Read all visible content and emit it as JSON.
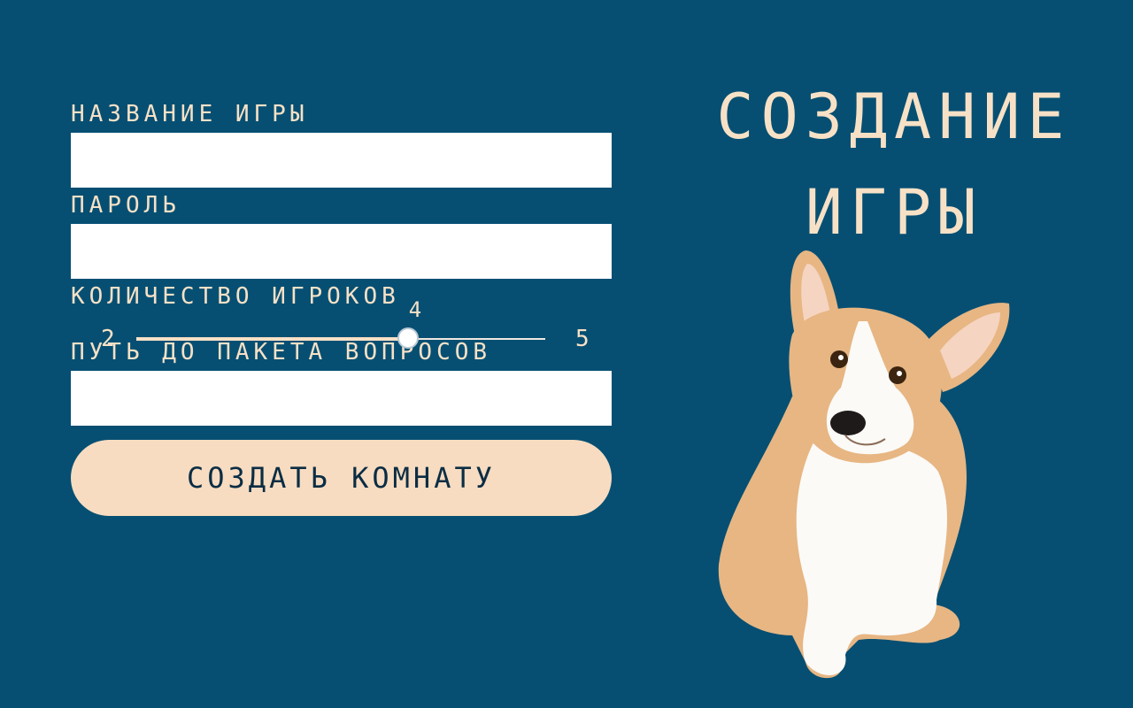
{
  "form": {
    "game_name_label": "НАЗВАНИЕ ИГРЫ",
    "game_name_value": "",
    "password_label": "ПАРОЛЬ",
    "password_value": "",
    "players_label": "КОЛИЧЕСТВО ИГРОКОВ",
    "players": {
      "min": "2",
      "max": "5",
      "value": "4",
      "min_num": 2,
      "max_num": 5,
      "value_num": 4
    },
    "package_path_label": "ПУТЬ ДО ПАКЕТА ВОПРОСОВ",
    "package_path_value": "",
    "submit_label": "СОЗДАТЬ КОМНАТУ"
  },
  "title": {
    "line1": "СОЗДАНИЕ",
    "line2": "ИГРЫ"
  },
  "illustration": {
    "icon": "corgi-dog-illustration"
  },
  "colors": {
    "background": "#064f73",
    "text": "#f7e1c6",
    "button": "#f7dcc1",
    "button_text": "#0b2d44"
  }
}
